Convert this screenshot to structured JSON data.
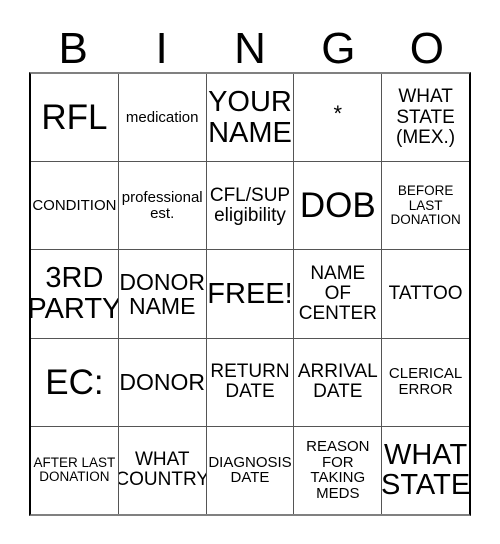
{
  "card": {
    "header_letters": [
      "B",
      "I",
      "N",
      "G",
      "O"
    ],
    "rows": [
      [
        {
          "text": "RFL",
          "size": "fs-xxl"
        },
        {
          "text": "medication",
          "size": "fs-sm"
        },
        {
          "text": "YOUR NAME",
          "size": "fs-xl"
        },
        {
          "text": "*",
          "size": "fs-star"
        },
        {
          "text": "WHAT STATE (MEX.)",
          "size": "fs-md"
        }
      ],
      [
        {
          "text": "CONDITION",
          "size": "fs-sm"
        },
        {
          "text": "professional est.",
          "size": "fs-sm"
        },
        {
          "text": "CFL/SUP eligibility",
          "size": "fs-md"
        },
        {
          "text": "DOB",
          "size": "fs-xxl"
        },
        {
          "text": "BEFORE LAST DONATION",
          "size": "fs-xs"
        }
      ],
      [
        {
          "text": "3RD PARTY",
          "size": "fs-xl"
        },
        {
          "text": "DONOR NAME",
          "size": "fs-lg"
        },
        {
          "text": "FREE!",
          "size": "fs-xl"
        },
        {
          "text": "NAME OF CENTER",
          "size": "fs-md"
        },
        {
          "text": "TATTOO",
          "size": "fs-md"
        }
      ],
      [
        {
          "text": "EC:",
          "size": "fs-xxl"
        },
        {
          "text": "DONOR",
          "size": "fs-lg"
        },
        {
          "text": "RETURN DATE",
          "size": "fs-md"
        },
        {
          "text": "ARRIVAL DATE",
          "size": "fs-md"
        },
        {
          "text": "CLERICAL ERROR",
          "size": "fs-sm"
        }
      ],
      [
        {
          "text": "AFTER LAST DONATION",
          "size": "fs-xs"
        },
        {
          "text": "WHAT COUNTRY",
          "size": "fs-md"
        },
        {
          "text": "DIAGNOSIS DATE",
          "size": "fs-sm"
        },
        {
          "text": "REASON FOR TAKING MEDS",
          "size": "fs-sm"
        },
        {
          "text": "WHAT STATE",
          "size": "fs-xl"
        }
      ]
    ]
  },
  "colors": {
    "background": "#ffffff",
    "text": "#000000",
    "grid_line": "#555555",
    "grid_border": "#000000"
  }
}
